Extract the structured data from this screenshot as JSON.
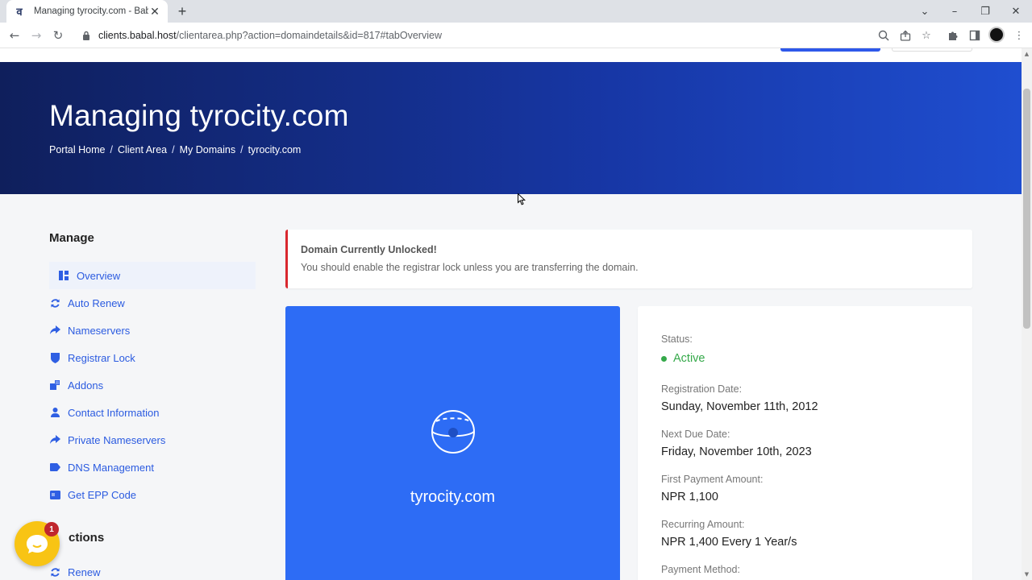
{
  "browser": {
    "tab_title": "Managing tyrocity.com - Babal.H",
    "favicon_glyph": "व",
    "url_host": "clients.babal.host",
    "url_path": "/clientarea.php?action=domaindetails&id=817#tabOverview"
  },
  "hero": {
    "title": "Managing tyrocity.com",
    "breadcrumb": [
      "Portal Home",
      "Client Area",
      "My Domains",
      "tyrocity.com"
    ],
    "breadcrumb_sep": "/"
  },
  "sidebar": {
    "heading": "Manage",
    "items": [
      {
        "label": "Overview",
        "icon": "grid-icon"
      },
      {
        "label": "Auto Renew",
        "icon": "refresh-icon"
      },
      {
        "label": "Nameservers",
        "icon": "share-arrow-icon"
      },
      {
        "label": "Registrar Lock",
        "icon": "shield-icon"
      },
      {
        "label": "Addons",
        "icon": "cubes-icon"
      },
      {
        "label": "Contact Information",
        "icon": "user-icon"
      },
      {
        "label": "Private Nameservers",
        "icon": "share-arrow-icon"
      },
      {
        "label": "DNS Management",
        "icon": "tag-icon"
      },
      {
        "label": "Get EPP Code",
        "icon": "card-icon"
      }
    ],
    "heading2": "ctions",
    "renew_label": "Renew"
  },
  "alert": {
    "title": "Domain Currently Unlocked!",
    "text": "You should enable the registrar lock unless you are transferring the domain."
  },
  "domain_card": {
    "name": "tyrocity.com"
  },
  "info": {
    "status_label": "Status:",
    "status_value": "Active",
    "reg_date_label": "Registration Date:",
    "reg_date_value": "Sunday, November 11th, 2012",
    "due_date_label": "Next Due Date:",
    "due_date_value": "Friday, November 10th, 2023",
    "first_payment_label": "First Payment Amount:",
    "first_payment_value": "NPR 1,100",
    "recurring_label": "Recurring Amount:",
    "recurring_value": "NPR 1,400 Every 1 Year/s",
    "payment_method_label": "Payment Method:"
  },
  "chat": {
    "badge_count": "1"
  },
  "colors": {
    "accent": "#2e58ea",
    "hero_dark": "#0f1f5c",
    "hero_light": "#1f4ed0",
    "alert_border": "#d9282f",
    "status_active": "#35a94a",
    "chat": "#f8c414"
  }
}
